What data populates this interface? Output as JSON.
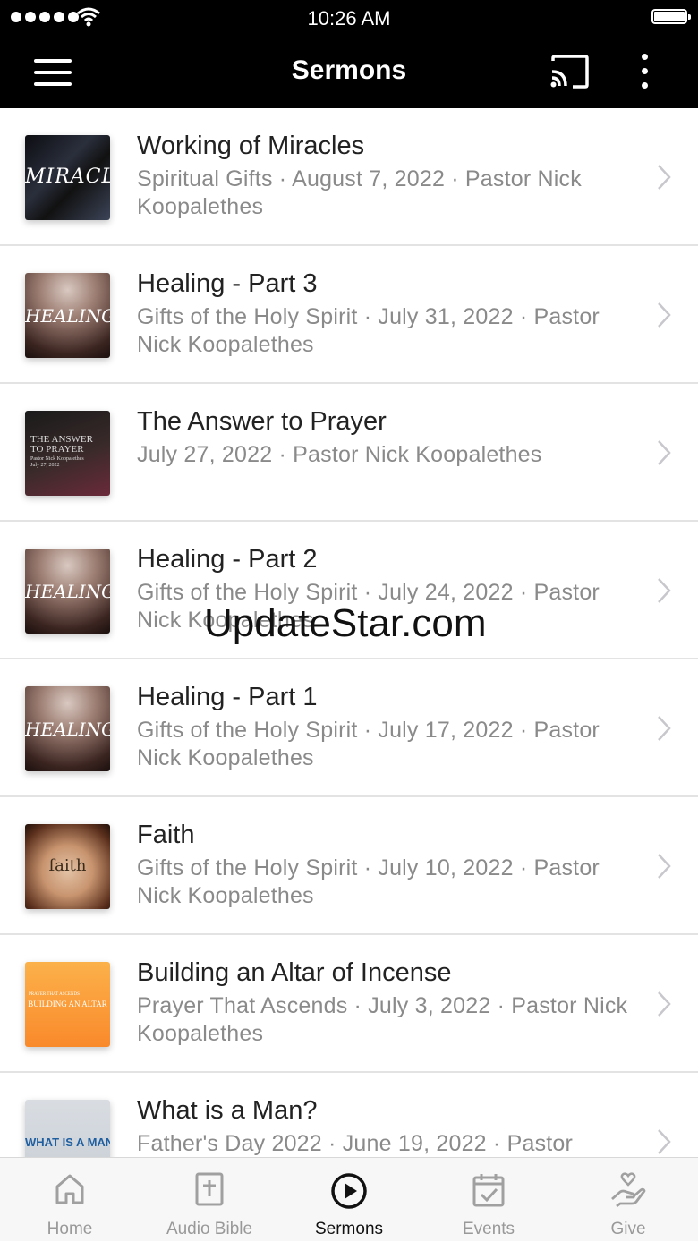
{
  "status_bar": {
    "time": "10:26 AM"
  },
  "nav": {
    "title": "Sermons"
  },
  "sermons": [
    {
      "title": "Working of Miracles",
      "subtitle": "Spiritual Gifts · August 7, 2022 · Pastor Nick Koopalethes",
      "thumb_text": "MIRACLES"
    },
    {
      "title": "Healing - Part 3",
      "subtitle": "Gifts of the Holy Spirit · July 31, 2022 · Pastor Nick Koopalethes",
      "thumb_text": "HEALING"
    },
    {
      "title": "The Answer to Prayer",
      "subtitle": "July 27, 2022 · Pastor Nick Koopalethes",
      "thumb_text": "THE ANSWER",
      "thumb_text2": "TO PRAYER",
      "thumb_text3": "Pastor Nick Koopalethes",
      "thumb_text4": "July 27, 2022"
    },
    {
      "title": "Healing - Part 2",
      "subtitle": "Gifts of the Holy Spirit · July 24, 2022 · Pastor Nick Koopalethes",
      "thumb_text": "HEALING"
    },
    {
      "title": "Healing - Part 1",
      "subtitle": "Gifts of the Holy Spirit · July 17, 2022 · Pastor Nick Koopalethes",
      "thumb_text": "HEALING"
    },
    {
      "title": "Faith",
      "subtitle": "Gifts of the Holy Spirit · July 10, 2022 · Pastor Nick Koopalethes",
      "thumb_text": "faith"
    },
    {
      "title": "Building an Altar of Incense",
      "subtitle": "Prayer That Ascends · July 3, 2022 · Pastor Nick Koopalethes",
      "thumb_text": "PRAYER THAT ASCENDS",
      "thumb_text2": "BUILDING AN ALTAR"
    },
    {
      "title": "What is a Man?",
      "subtitle": "Father's Day 2022 · June 19, 2022 · Pastor",
      "thumb_text": "WHAT IS A MAN?"
    }
  ],
  "watermark": "UpdateStar.com",
  "tabs": [
    {
      "label": "Home",
      "icon": "home-icon"
    },
    {
      "label": "Audio Bible",
      "icon": "bible-icon"
    },
    {
      "label": "Sermons",
      "icon": "play-circle-icon",
      "active": true
    },
    {
      "label": "Events",
      "icon": "calendar-check-icon"
    },
    {
      "label": "Give",
      "icon": "hand-heart-icon"
    }
  ],
  "colors": {
    "nav_background": "#000000",
    "subtitle": "#8a8a8a",
    "tab_inactive": "#999999",
    "tab_active": "#111111"
  }
}
